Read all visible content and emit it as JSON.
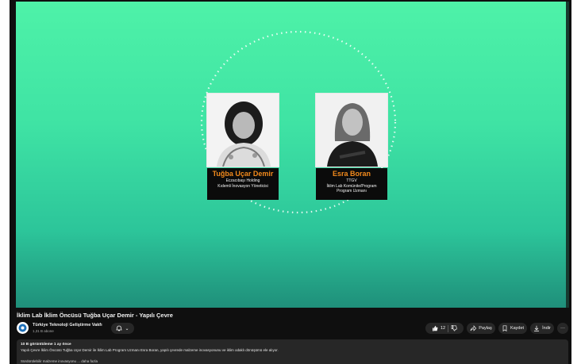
{
  "video": {
    "speakers": [
      {
        "name": "Tuğba Uçar Demir",
        "line1": "Eczacıbaşı Holding",
        "line2": "Kıdemli İnovasyon Yöneticisi",
        "line3": ""
      },
      {
        "name": "Esra Boran",
        "line1": "TTGV",
        "line2": "İklim Lab Komünite/Program",
        "line3": "Program Uzmanı"
      }
    ]
  },
  "meta": {
    "title": "İklim Lab İklim Öncüsü Tuğba Uçar Demir - Yapılı Çevre",
    "channel_name": "Türkiye Teknoloji Geliştirme Vakfı",
    "subscribers": "1,31 B abone",
    "bell_caret": "⌄",
    "likes": "12",
    "share_label": "Paylaş",
    "save_label": "Kaydet",
    "download_label": "İndir",
    "more_label": "···"
  },
  "description": {
    "views_date": "10 B görüntüleme  1 ay önce",
    "text": "Yapılı Çevre İklim Öncüsü Tuğba Uçar Demir ile İklim Lab Program Uzmanı Esra Boran, yapılı çevrede malzeme inovasyonunu ve iklim odaklı dönüşümü ele alıyor.",
    "more": "Sürdürülebilir malzeme inovasyonu ...   daha fazla"
  },
  "colors": {
    "accent": "#f28a1c",
    "video_top": "#4ef2a8",
    "video_bottom": "#1f8f7a"
  },
  "icons": [
    "like-icon",
    "dislike-icon",
    "share-icon",
    "save-icon",
    "download-icon",
    "bell-icon",
    "more-icon"
  ]
}
